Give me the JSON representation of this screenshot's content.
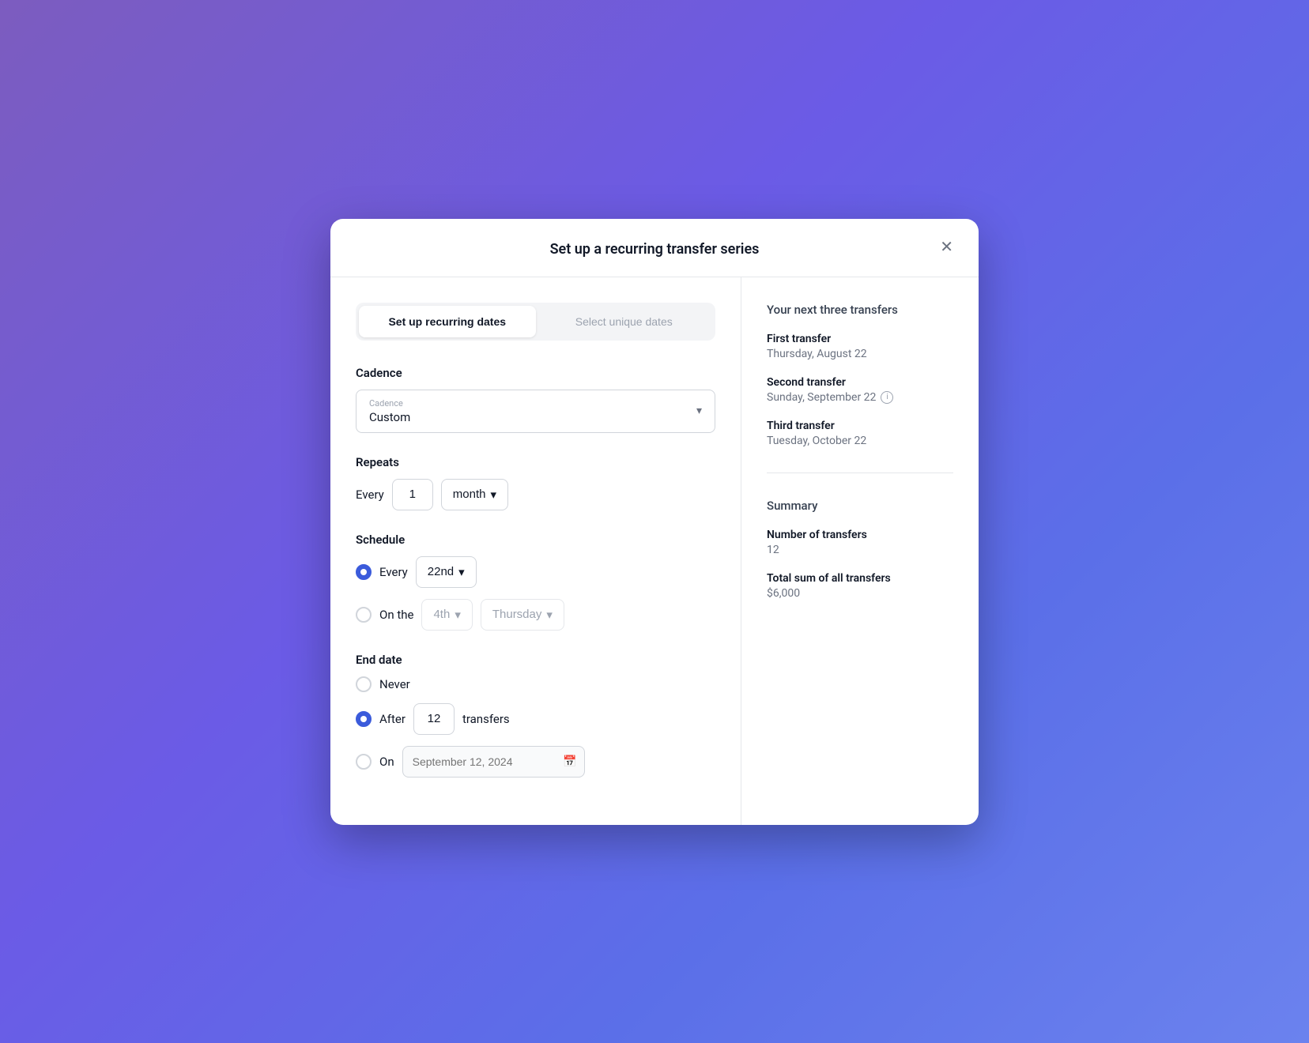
{
  "modal": {
    "title": "Set up a recurring transfer series"
  },
  "tabs": {
    "active_label": "Set up recurring dates",
    "inactive_label": "Select unique dates"
  },
  "cadence": {
    "section_label": "Cadence",
    "field_label": "Cadence",
    "value": "Custom"
  },
  "repeats": {
    "section_label": "Repeats",
    "every_label": "Every",
    "number_value": "1",
    "unit_value": "month"
  },
  "schedule": {
    "section_label": "Schedule",
    "every_label": "Every",
    "every_day": "22nd",
    "on_the_label": "On the",
    "ordinal_value": "4th",
    "day_value": "Thursday"
  },
  "end_date": {
    "section_label": "End date",
    "never_label": "Never",
    "after_label": "After",
    "after_number": "12",
    "transfers_label": "transfers",
    "on_label": "On",
    "date_placeholder": "September 12, 2024"
  },
  "right_panel": {
    "transfers_title": "Your next three transfers",
    "transfers": [
      {
        "name": "First transfer",
        "date": "Thursday, August 22",
        "has_info": false
      },
      {
        "name": "Second transfer",
        "date": "Sunday, September 22",
        "has_info": true
      },
      {
        "name": "Third transfer",
        "date": "Tuesday, October 22",
        "has_info": false
      }
    ],
    "summary_title": "Summary",
    "summary_items": [
      {
        "label": "Number of transfers",
        "value": "12"
      },
      {
        "label": "Total sum of all transfers",
        "value": "$6,000"
      }
    ]
  }
}
